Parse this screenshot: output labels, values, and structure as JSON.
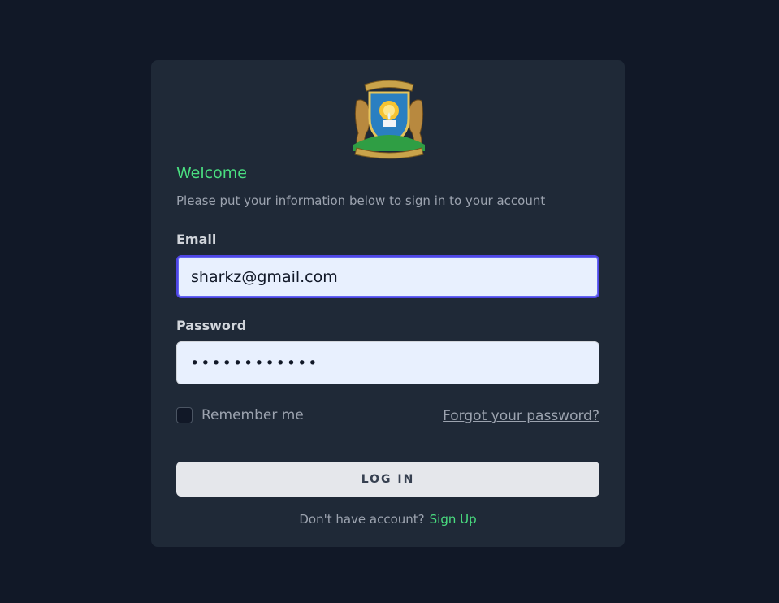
{
  "heading": "Welcome",
  "subtitle": "Please put your information below to sign in to your account",
  "email": {
    "label": "Email",
    "value": "sharkz@gmail.com"
  },
  "password": {
    "label": "Password",
    "value": "••••••••••••"
  },
  "remember": {
    "label": "Remember me",
    "checked": false
  },
  "forgot_link": "Forgot your password?",
  "login_button": "LOG IN",
  "signup": {
    "prompt": "Don't have account?",
    "link": "Sign Up"
  },
  "colors": {
    "background": "#111827",
    "card": "#1f2937",
    "accent": "#4ade80",
    "focus": "#4f46e5"
  }
}
